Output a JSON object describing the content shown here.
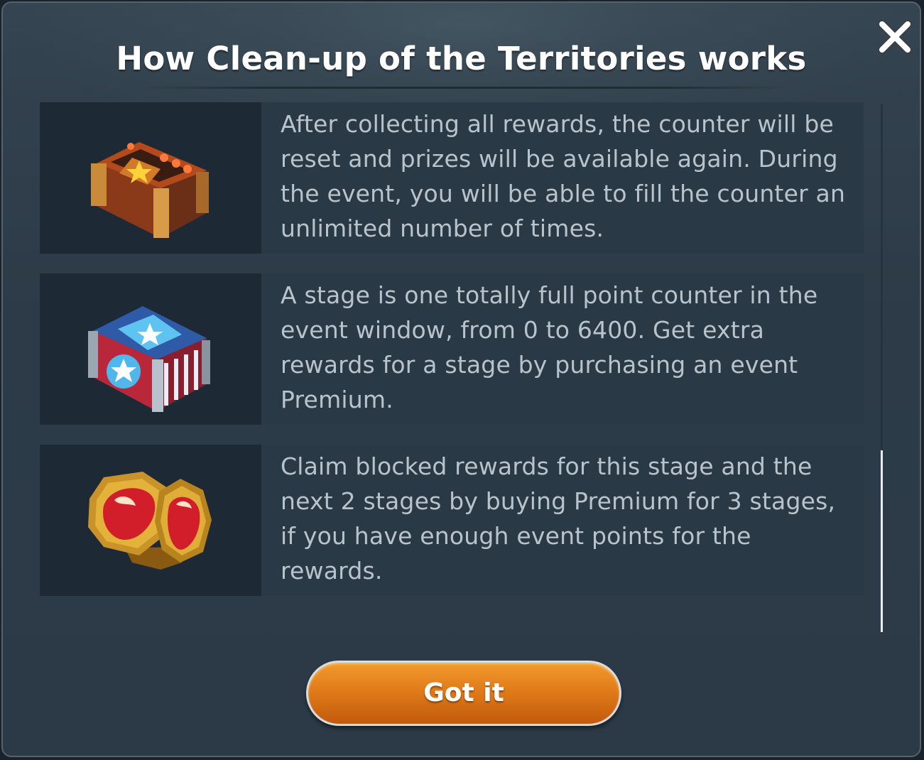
{
  "dialog": {
    "title": "How Clean-up of the Territories works",
    "close_icon": "close-icon",
    "confirm_label": "Got it"
  },
  "cards": [
    {
      "icon": "orange-star-chest-icon",
      "text": "After collecting all rewards, the counter will be reset and prizes will be available again. During the event, you will be able to fill the counter an unlimited number of times."
    },
    {
      "icon": "stars-and-stripes-chest-icon",
      "text": "A stage is one totally full point counter in the event window, from 0 to 6400. Get extra rewards for a stage by purchasing an event Premium."
    },
    {
      "icon": "gold-red-tokens-icon",
      "text": "Claim blocked rewards for this stage and the next 2 stages by buying Premium for 3 stages, if you have enough event points for the rewards."
    }
  ],
  "colors": {
    "button_orange": "#e07c1a",
    "panel_bg": "#2f3e4b",
    "card_text": "#b9c3cb"
  }
}
